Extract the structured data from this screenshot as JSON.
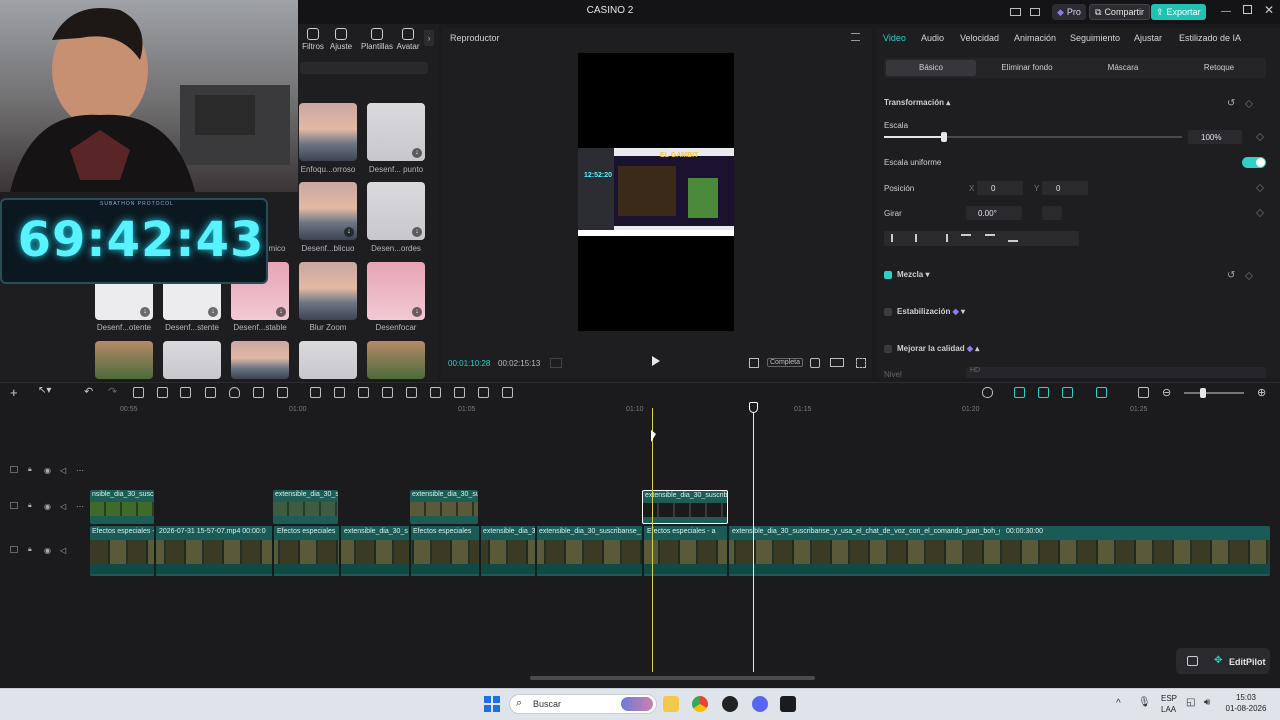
{
  "window": {
    "title": "CASINO 2",
    "pro_label": "Pro",
    "share_label": "Compartir",
    "export_label": "Exportar"
  },
  "media": {
    "tool_tabs": [
      "Filtros",
      "Ajuste",
      "Plantillas",
      "Avatar"
    ],
    "effects_row1": [
      "Enfoqu...orroso",
      "Desenf... punto"
    ],
    "effects_row2": [
      "mico",
      "Desenf...blicuo",
      "Desen...ordes"
    ],
    "effects_row3": [
      "Desenf...otente",
      "Desenf...stente",
      "Desenf...stable",
      "Blur Zoom",
      "Desenfocar"
    ]
  },
  "overlay": {
    "timer": "69:42:43",
    "caption": "SUBATHON PROTOCOL"
  },
  "player": {
    "title": "Reproductor",
    "current_time": "00:01:10:28",
    "total_time": "00:02:15:13",
    "view_mode": "Completa",
    "inner_logo": "EL GAMBIT",
    "inner_clock": "12:52:20"
  },
  "props": {
    "tabs": [
      "Video",
      "Audio",
      "Velocidad",
      "Animación",
      "Seguimiento",
      "Ajustar",
      "Estilizado de IA"
    ],
    "subtabs": [
      "Básico",
      "Eliminar fondo",
      "Máscara",
      "Retoque"
    ],
    "transform_label": "Transformación",
    "scale_label": "Escala",
    "scale_value": "100%",
    "uniform_label": "Escala uniforme",
    "position_label": "Posición",
    "x_label": "X",
    "x_value": "0",
    "y_label": "Y",
    "y_value": "0",
    "rotate_label": "Girar",
    "rotate_value": "0.00°",
    "blend_label": "Mezcla",
    "stabilize_label": "Estabilización",
    "enhance_label": "Mejorar la calidad",
    "nivel_label": "Nivel",
    "nivel_value": "HD"
  },
  "timeline": {
    "ticks": [
      "00:55",
      "01:00",
      "01:05",
      "01:10",
      "01:15",
      "01:20",
      "01:25"
    ],
    "overlay_clips": [
      "nsible_dia_30_suscrib",
      "extensible_dia_30_su",
      "extensible_dia_30_su",
      "extensible_dia_30_suscrib"
    ],
    "main_labels": [
      "Efectos especiales - a",
      "2026-07-31 15-57-07.mp4  00:00:0",
      "Efectos especiales",
      "extensible_dia_30_sus",
      "Efectos especiales",
      "extensible_dia_30",
      "extensible_dia_30_suscribanse_y",
      "Efectos especiales - a",
      "extensible_dia_30_suscribanse_y_usa_el_chat_de_voz_con_el_comando_juan_boh_gh_ni1ti",
      "00:00:30:00"
    ],
    "editpilot_label": "EditPilot"
  },
  "taskbar": {
    "search_placeholder": "Buscar",
    "lang_top": "ESP",
    "lang_bottom": "LAA",
    "time": "15:03",
    "date": "01-08-2026"
  },
  "colors": {
    "accent": "#2fd1c4",
    "timer": "#59f2ff",
    "clip": "#1a5b57"
  }
}
